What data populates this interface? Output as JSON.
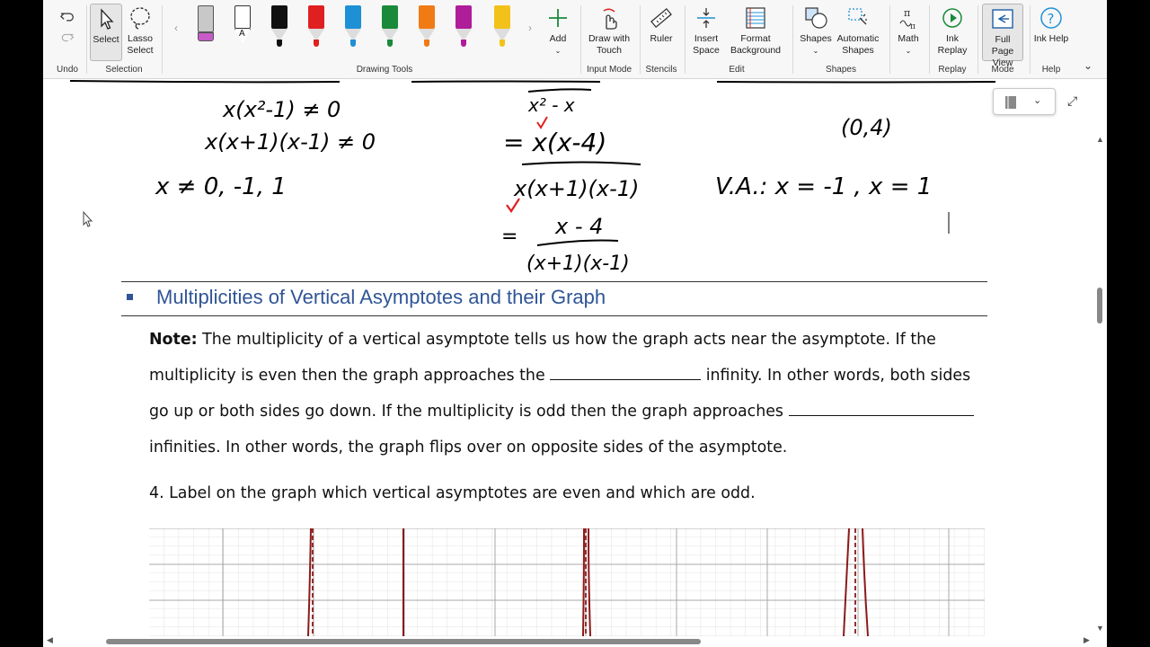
{
  "ribbon": {
    "undo": {
      "label": "Undo",
      "group": "Undo"
    },
    "selection": {
      "select_label": "Select",
      "lasso_label": "Lasso Select",
      "group": "Selection"
    },
    "drawing_tools": {
      "group": "Drawing Tools",
      "pens": [
        {
          "name": "eraser",
          "color": "#c8c8c8"
        },
        {
          "name": "pencil",
          "color": "#ffffff"
        },
        {
          "name": "black-pen",
          "color": "#111111"
        },
        {
          "name": "red-pen",
          "color": "#e02020"
        },
        {
          "name": "blue-pen",
          "color": "#1e90d6"
        },
        {
          "name": "green-pen",
          "color": "#1a8a3a"
        },
        {
          "name": "orange-pen",
          "color": "#f07a14"
        },
        {
          "name": "purple-pen",
          "color": "#b01d9a"
        },
        {
          "name": "yellow-highlighter",
          "color": "#f2c21a"
        }
      ],
      "add_label": "Add"
    },
    "input_mode": {
      "label": "Draw with Touch",
      "group": "Input Mode"
    },
    "stencils": {
      "label": "Ruler",
      "group": "Stencils"
    },
    "edit": {
      "insert_space": "Insert Space",
      "format_background": "Format Background",
      "group": "Edit"
    },
    "shapes": {
      "shapes_label": "Shapes",
      "automatic_label": "Automatic Shapes",
      "group": "Shapes"
    },
    "math": {
      "label": "Math"
    },
    "replay": {
      "label": "Ink Replay",
      "group": "Replay"
    },
    "mode": {
      "label": "Full Page View",
      "group": "Mode"
    },
    "help": {
      "label": "Ink Help",
      "group": "Help"
    }
  },
  "document": {
    "heading": "Multiplicities of Vertical Asymptotes and their Graph",
    "note_label": "Note:",
    "note_line1": " The multiplicity of a vertical asymptote tells us how the graph acts near the asymptote. If the",
    "note_line2a": "multiplicity is even then the graph approaches the ",
    "note_line2b": " infinity. In other words, both sides",
    "note_line3a": "go up or both sides go down. If the multiplicity is odd then the graph approaches ",
    "note_line4": "infinities. In other words, the graph flips over on opposite sides of the asymptote.",
    "question4": "4. Label on the graph which vertical asymptotes are even and which are odd.",
    "handwriting": {
      "line_a": "x(x²-1) ≠ 0",
      "line_b": "x(x+1)(x-1) ≠ 0",
      "line_c": "x ≠ 0, -1, 1",
      "mid_a": "x² - x",
      "mid_b": "= x(x-4)",
      "mid_c": "x(x+1)(x-1)",
      "mid_d": "x - 4",
      "mid_e": "(x+1)(x-1)",
      "mid_f": "=",
      "right_a": "(0,4)",
      "right_b": "V.A.: x = -1 , x = 1"
    }
  },
  "colors": {
    "accent": "#2f5597",
    "ink": "#000000",
    "check": "#e02020",
    "asymptote": "#8b1a1a"
  }
}
